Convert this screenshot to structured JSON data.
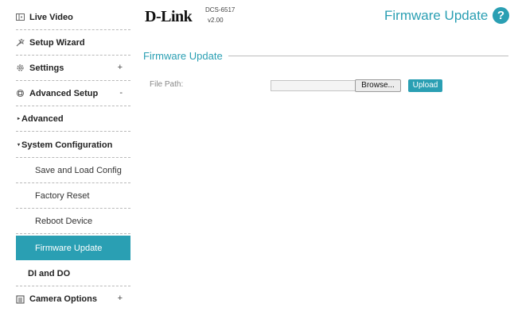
{
  "sidebar": {
    "items": [
      {
        "label": "Live Video",
        "icon": "video-icon"
      },
      {
        "label": "Setup Wizard",
        "icon": "wizard-icon"
      },
      {
        "label": "Settings",
        "icon": "gear-icon",
        "toggle": "+"
      },
      {
        "label": "Advanced Setup",
        "icon": "advanced-icon",
        "toggle": "-"
      },
      {
        "label": "Advanced",
        "icon": "arrow-icon"
      },
      {
        "label": "System Configuration",
        "icon": "arrow-icon"
      },
      {
        "label": "Save and Load Config"
      },
      {
        "label": "Factory Reset"
      },
      {
        "label": "Reboot Device"
      },
      {
        "label": "Firmware Update",
        "active": true
      },
      {
        "label": "DI and DO"
      },
      {
        "label": "Camera Options",
        "icon": "camera-options-icon",
        "toggle": "+"
      }
    ]
  },
  "header": {
    "logo": "D-Link",
    "model": "DCS-6517",
    "version": "v2.00",
    "title": "Firmware Update",
    "help": "?"
  },
  "main": {
    "section_title": "Firmware Update",
    "file_path_label": "File Path:",
    "file_path_value": "",
    "browse_label": "Browse...",
    "upload_label": "Upload"
  },
  "colors": {
    "accent": "#2a9fb3"
  }
}
